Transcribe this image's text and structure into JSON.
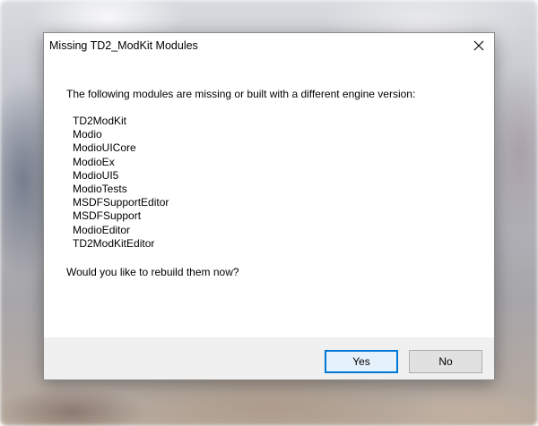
{
  "window": {
    "title": "Missing TD2_ModKit Modules",
    "close_icon": "close-icon"
  },
  "dialog": {
    "message": "The following modules are missing or built with a different engine version:",
    "modules": [
      "TD2ModKit",
      "Modio",
      "ModioUICore",
      "ModioEx",
      "ModioUI5",
      "ModioTests",
      "MSDFSupportEditor",
      "MSDFSupport",
      "ModioEditor",
      "TD2ModKitEditor"
    ],
    "question": "Would you like to rebuild them now?"
  },
  "buttons": {
    "yes_label": "Yes",
    "no_label": "No"
  },
  "colors": {
    "accent": "#0078d7",
    "footer_bg": "#f0f0f0",
    "button_bg": "#e1e1e1"
  }
}
